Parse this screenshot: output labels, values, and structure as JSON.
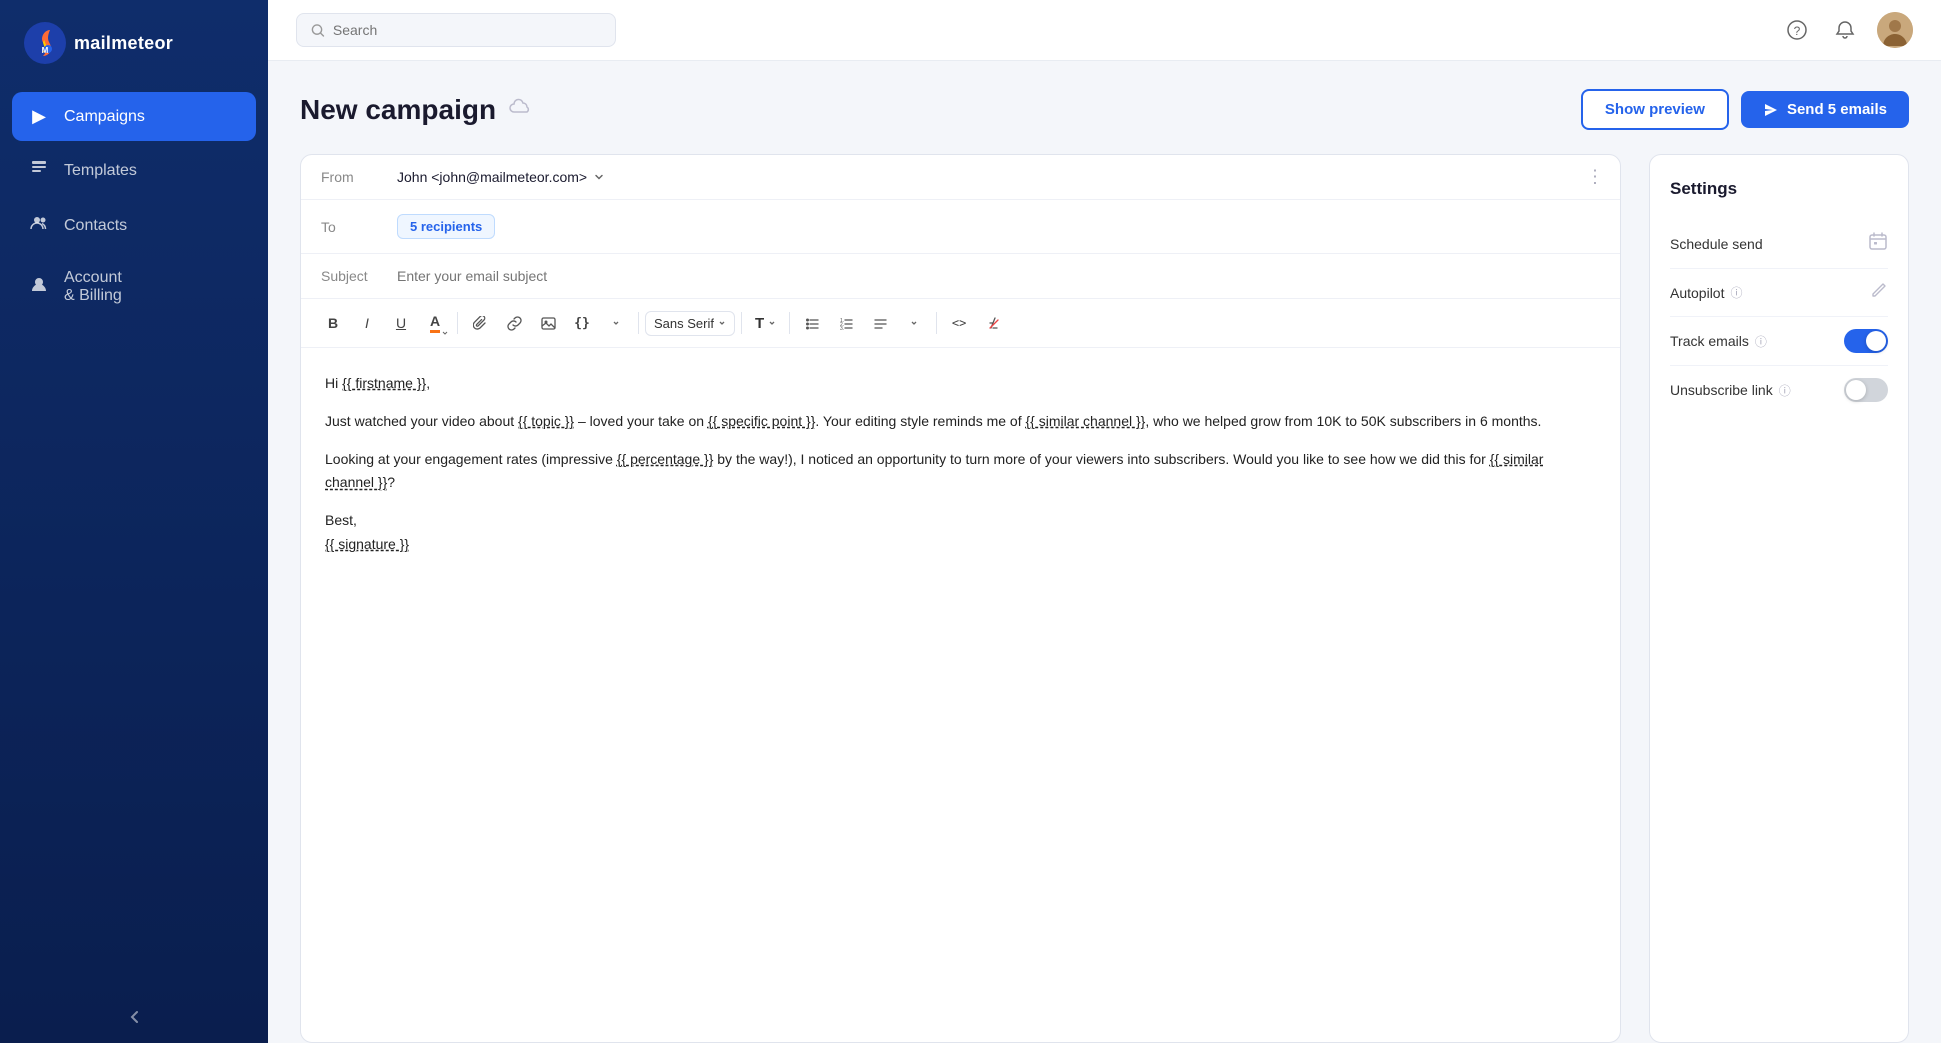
{
  "app": {
    "name": "mailmeteor"
  },
  "topbar": {
    "search_placeholder": "Search"
  },
  "sidebar": {
    "items": [
      {
        "id": "campaigns",
        "label": "Campaigns",
        "active": true,
        "icon": "▶"
      },
      {
        "id": "templates",
        "label": "Templates",
        "active": false,
        "icon": "📄"
      },
      {
        "id": "contacts",
        "label": "Contacts",
        "active": false,
        "icon": "👥"
      },
      {
        "id": "account-billing",
        "label": "Account & Billing",
        "active": false,
        "icon": "⚙"
      }
    ]
  },
  "page": {
    "title": "New campaign",
    "show_preview_label": "Show preview",
    "send_button_label": "Send 5 emails"
  },
  "composer": {
    "from_label": "From",
    "from_value": "John <john@mailmeteor.com>",
    "to_label": "To",
    "recipients_label": "5 recipients",
    "subject_label": "Subject",
    "subject_placeholder": "Enter your email subject",
    "toolbar": {
      "bold": "B",
      "italic": "I",
      "underline": "U",
      "text_color": "A",
      "attachment": "📎",
      "link": "🔗",
      "image": "🖼",
      "variable": "{}",
      "font_name": "Sans Serif",
      "font_size": "T",
      "bullet_list": "≡",
      "number_list": "≡",
      "align": "≡",
      "code": "<>",
      "clear": "✕"
    },
    "body_lines": [
      "Hi {{ firstname }},",
      "",
      "Just watched your video about {{ topic }} – loved your take on {{ specific point }}. Your editing style reminds me of {{ similar channel }}, who we helped grow from 10K to 50K subscribers in 6 months.",
      "",
      "Looking at your engagement rates (impressive {{ percentage }} by the way!), I noticed an opportunity to turn more of your viewers into subscribers. Would you like to see how we did this for {{ similar channel }}?",
      "",
      "Best,",
      "{{ signature }}"
    ]
  },
  "settings": {
    "title": "Settings",
    "items": [
      {
        "id": "schedule-send",
        "label": "Schedule send",
        "type": "icon",
        "icon": "calendar"
      },
      {
        "id": "autopilot",
        "label": "Autopilot",
        "type": "icon",
        "icon": "pencil",
        "has_info": true
      },
      {
        "id": "track-emails",
        "label": "Track emails",
        "type": "toggle",
        "state": "on",
        "has_info": true
      },
      {
        "id": "unsubscribe-link",
        "label": "Unsubscribe link",
        "type": "toggle",
        "state": "off",
        "has_info": true
      }
    ]
  }
}
